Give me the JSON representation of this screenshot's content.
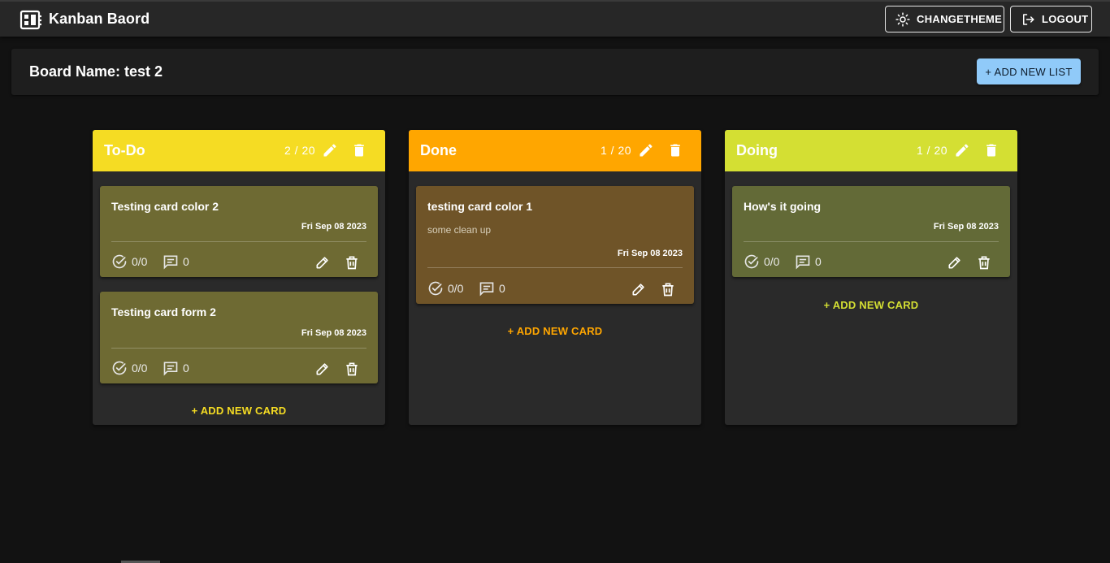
{
  "app": {
    "title": "Kanban Baord",
    "logo_icon": "dashboard-icon"
  },
  "toolbar": {
    "theme_label": "CHANGETHEME",
    "theme_icon": "sun-icon",
    "logout_label": "LOGOUT",
    "logout_icon": "logout-icon"
  },
  "board": {
    "title": "Board Name: test 2",
    "add_list_label": "+ ADD NEW LIST"
  },
  "lists": [
    {
      "title": "To-Do",
      "count": "2 / 20",
      "color": "#f5dc23",
      "card_color": "#6e6a33",
      "add_card_color": "#f5dc23",
      "add_card_label": "+ ADD NEW CARD",
      "cards": [
        {
          "title": "Testing card color 2",
          "date": "Fri Sep 08 2023",
          "checklist": "0/0",
          "comments": "0"
        },
        {
          "title": "Testing card form 2",
          "date": "Fri Sep 08 2023",
          "checklist": "0/0",
          "comments": "0"
        }
      ]
    },
    {
      "title": "Done",
      "count": "1 / 20",
      "color": "#ffa600",
      "card_color": "#6f5428",
      "add_card_color": "#ffa600",
      "add_card_label": "+ ADD NEW CARD",
      "cards": [
        {
          "title": "testing card color 1",
          "description": "some clean up",
          "date": "Fri Sep 08 2023",
          "checklist": "0/0",
          "comments": "0"
        }
      ]
    },
    {
      "title": "Doing",
      "count": "1 / 20",
      "color": "#d4df33",
      "card_color": "#636a37",
      "add_card_color": "#d4df33",
      "add_card_label": "+ ADD NEW CARD",
      "cards": [
        {
          "title": "How's it going",
          "date": "Fri Sep 08 2023",
          "checklist": "0/0",
          "comments": "0"
        }
      ]
    }
  ]
}
